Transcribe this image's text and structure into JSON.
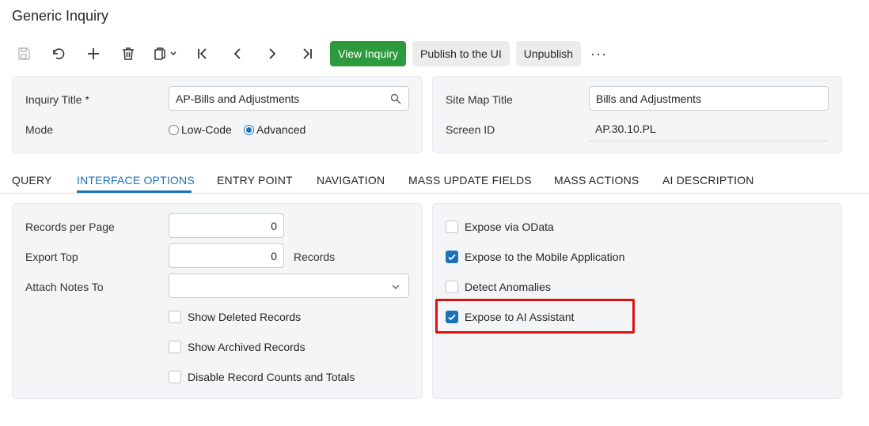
{
  "page": {
    "title": "Generic Inquiry"
  },
  "toolbar": {
    "view_inquiry": "View Inquiry",
    "publish": "Publish to the UI",
    "unpublish": "Unpublish",
    "more": "···",
    "icons": [
      "save-icon",
      "undo-icon",
      "add-icon",
      "delete-icon",
      "copy-paste-icon",
      "first-icon",
      "previous-icon",
      "next-icon",
      "last-icon"
    ]
  },
  "header_left": {
    "inquiry_title_label": "Inquiry Title *",
    "inquiry_title_value": "AP-Bills and Adjustments",
    "mode_label": "Mode",
    "mode_low_code": "Low-Code",
    "mode_advanced": "Advanced",
    "mode_selected": "Advanced"
  },
  "header_right": {
    "site_map_title_label": "Site Map Title",
    "site_map_title_value": "Bills and Adjustments",
    "screen_id_label": "Screen ID",
    "screen_id_value": "AP.30.10.PL"
  },
  "tabs": [
    {
      "label": "QUERY"
    },
    {
      "label": "INTERFACE OPTIONS",
      "active": true
    },
    {
      "label": "ENTRY POINT"
    },
    {
      "label": "NAVIGATION"
    },
    {
      "label": "MASS UPDATE FIELDS"
    },
    {
      "label": "MASS ACTIONS"
    },
    {
      "label": "AI DESCRIPTION"
    }
  ],
  "interface_left": {
    "records_per_page_label": "Records per Page",
    "records_per_page_value": "0",
    "export_top_label": "Export Top",
    "export_top_value": "0",
    "export_top_suffix": "Records",
    "attach_notes_label": "Attach Notes To",
    "attach_notes_value": "",
    "show_deleted": "Show Deleted Records",
    "show_archived": "Show Archived Records",
    "disable_counts": "Disable Record Counts and Totals"
  },
  "interface_right": {
    "expose_odata": "Expose via OData",
    "expose_mobile": "Expose to the Mobile Application",
    "detect_anomalies": "Detect Anomalies",
    "expose_ai": "Expose to AI Assistant"
  },
  "colors": {
    "primary": "#2e9a3e",
    "accent": "#1a73b8",
    "highlight": "#e01010"
  }
}
